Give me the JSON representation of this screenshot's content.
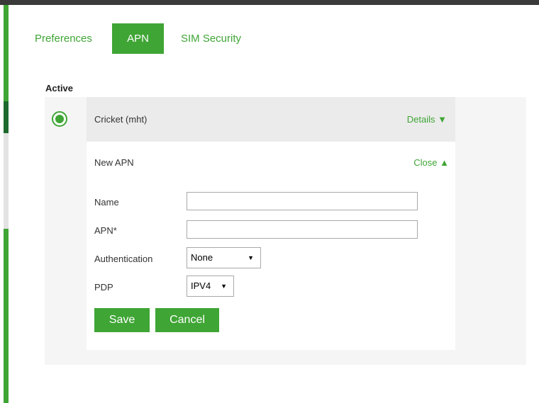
{
  "tabs": [
    {
      "label": "Preferences",
      "active": false
    },
    {
      "label": "APN",
      "active": true
    },
    {
      "label": "SIM Security",
      "active": false
    }
  ],
  "section": {
    "active_label": "Active"
  },
  "apn_list": {
    "items": [
      {
        "name": "Cricket (mht)",
        "selected": true,
        "details_label": "Details ▼"
      }
    ]
  },
  "new_apn": {
    "title": "New APN",
    "close_label": "Close ▲",
    "fields": {
      "name": {
        "label": "Name",
        "value": "",
        "placeholder": ""
      },
      "apn": {
        "label": "APN*",
        "value": "",
        "placeholder": ""
      },
      "authentication": {
        "label": "Authentication",
        "selected": "None"
      },
      "pdp": {
        "label": "PDP",
        "selected": "IPV4"
      }
    },
    "save_label": "Save",
    "cancel_label": "Cancel"
  },
  "icons": {
    "radio": "radio-selected-icon",
    "dropdown_arrow": "caret-down-icon"
  },
  "colors": {
    "accent": "#3fa535",
    "top_bar": "#3a3a3a",
    "panel_bg": "#f5f5f5",
    "row_bg": "#ebebeb"
  }
}
